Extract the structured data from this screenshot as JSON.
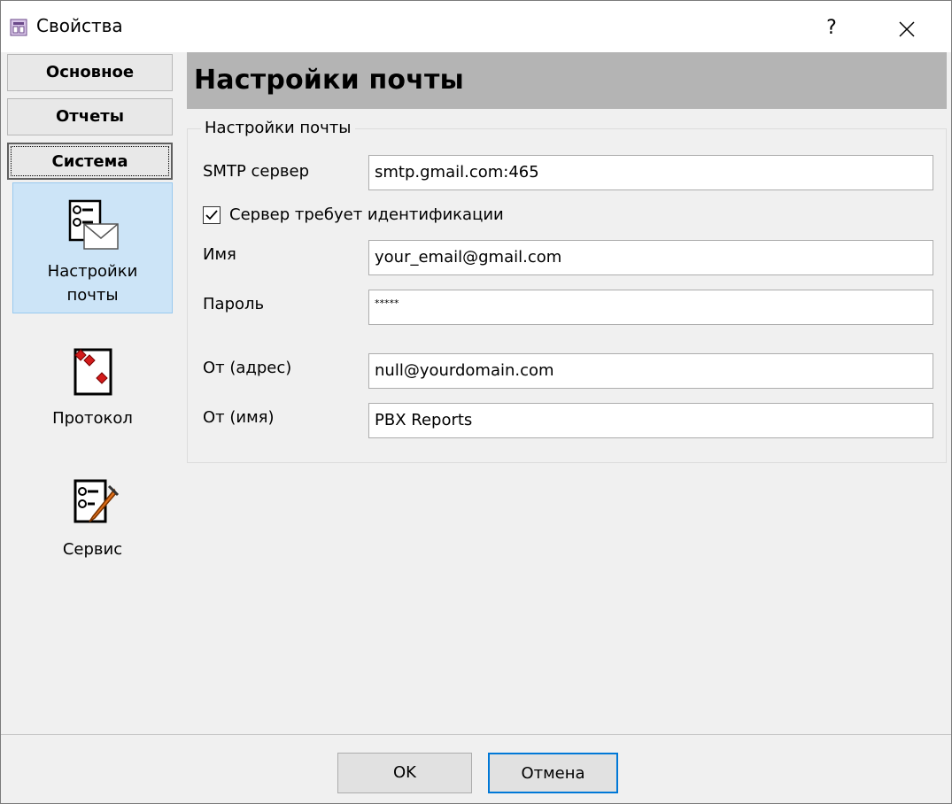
{
  "window": {
    "title": "Свойства",
    "help": "?",
    "close": "✕"
  },
  "nav": {
    "tabs": [
      {
        "label": "Основное"
      },
      {
        "label": "Отчеты"
      },
      {
        "label": "Система"
      }
    ],
    "items": [
      {
        "label_line1": "Настройки",
        "label_line2": "почты",
        "icon": "mail-settings-icon",
        "selected": true
      },
      {
        "label_line1": "Протокол",
        "label_line2": "",
        "icon": "protocol-icon",
        "selected": false
      },
      {
        "label_line1": "Сервис",
        "label_line2": "",
        "icon": "service-icon",
        "selected": false
      }
    ]
  },
  "main": {
    "header": "Настройки почты",
    "group_title": "Настройки почты",
    "fields": {
      "smtp": {
        "label": "SMTP сервер",
        "value": "smtp.gmail.com:465"
      },
      "auth_checkbox": {
        "label": "Сервер требует идентификации",
        "checked": true
      },
      "name": {
        "label": "Имя",
        "value": "your_email@gmail.com"
      },
      "password": {
        "label": "Пароль",
        "value": "*****"
      },
      "from_address": {
        "label": "От (адрес)",
        "value": "null@yourdomain.com"
      },
      "from_name": {
        "label": "От (имя)",
        "value": "PBX Reports"
      }
    }
  },
  "buttons": {
    "ok": "OK",
    "cancel": "Отмена"
  },
  "colors": {
    "selected_bg": "#cce4f7",
    "header_bg": "#b4b4b4",
    "focus_border": "#0078d7"
  }
}
